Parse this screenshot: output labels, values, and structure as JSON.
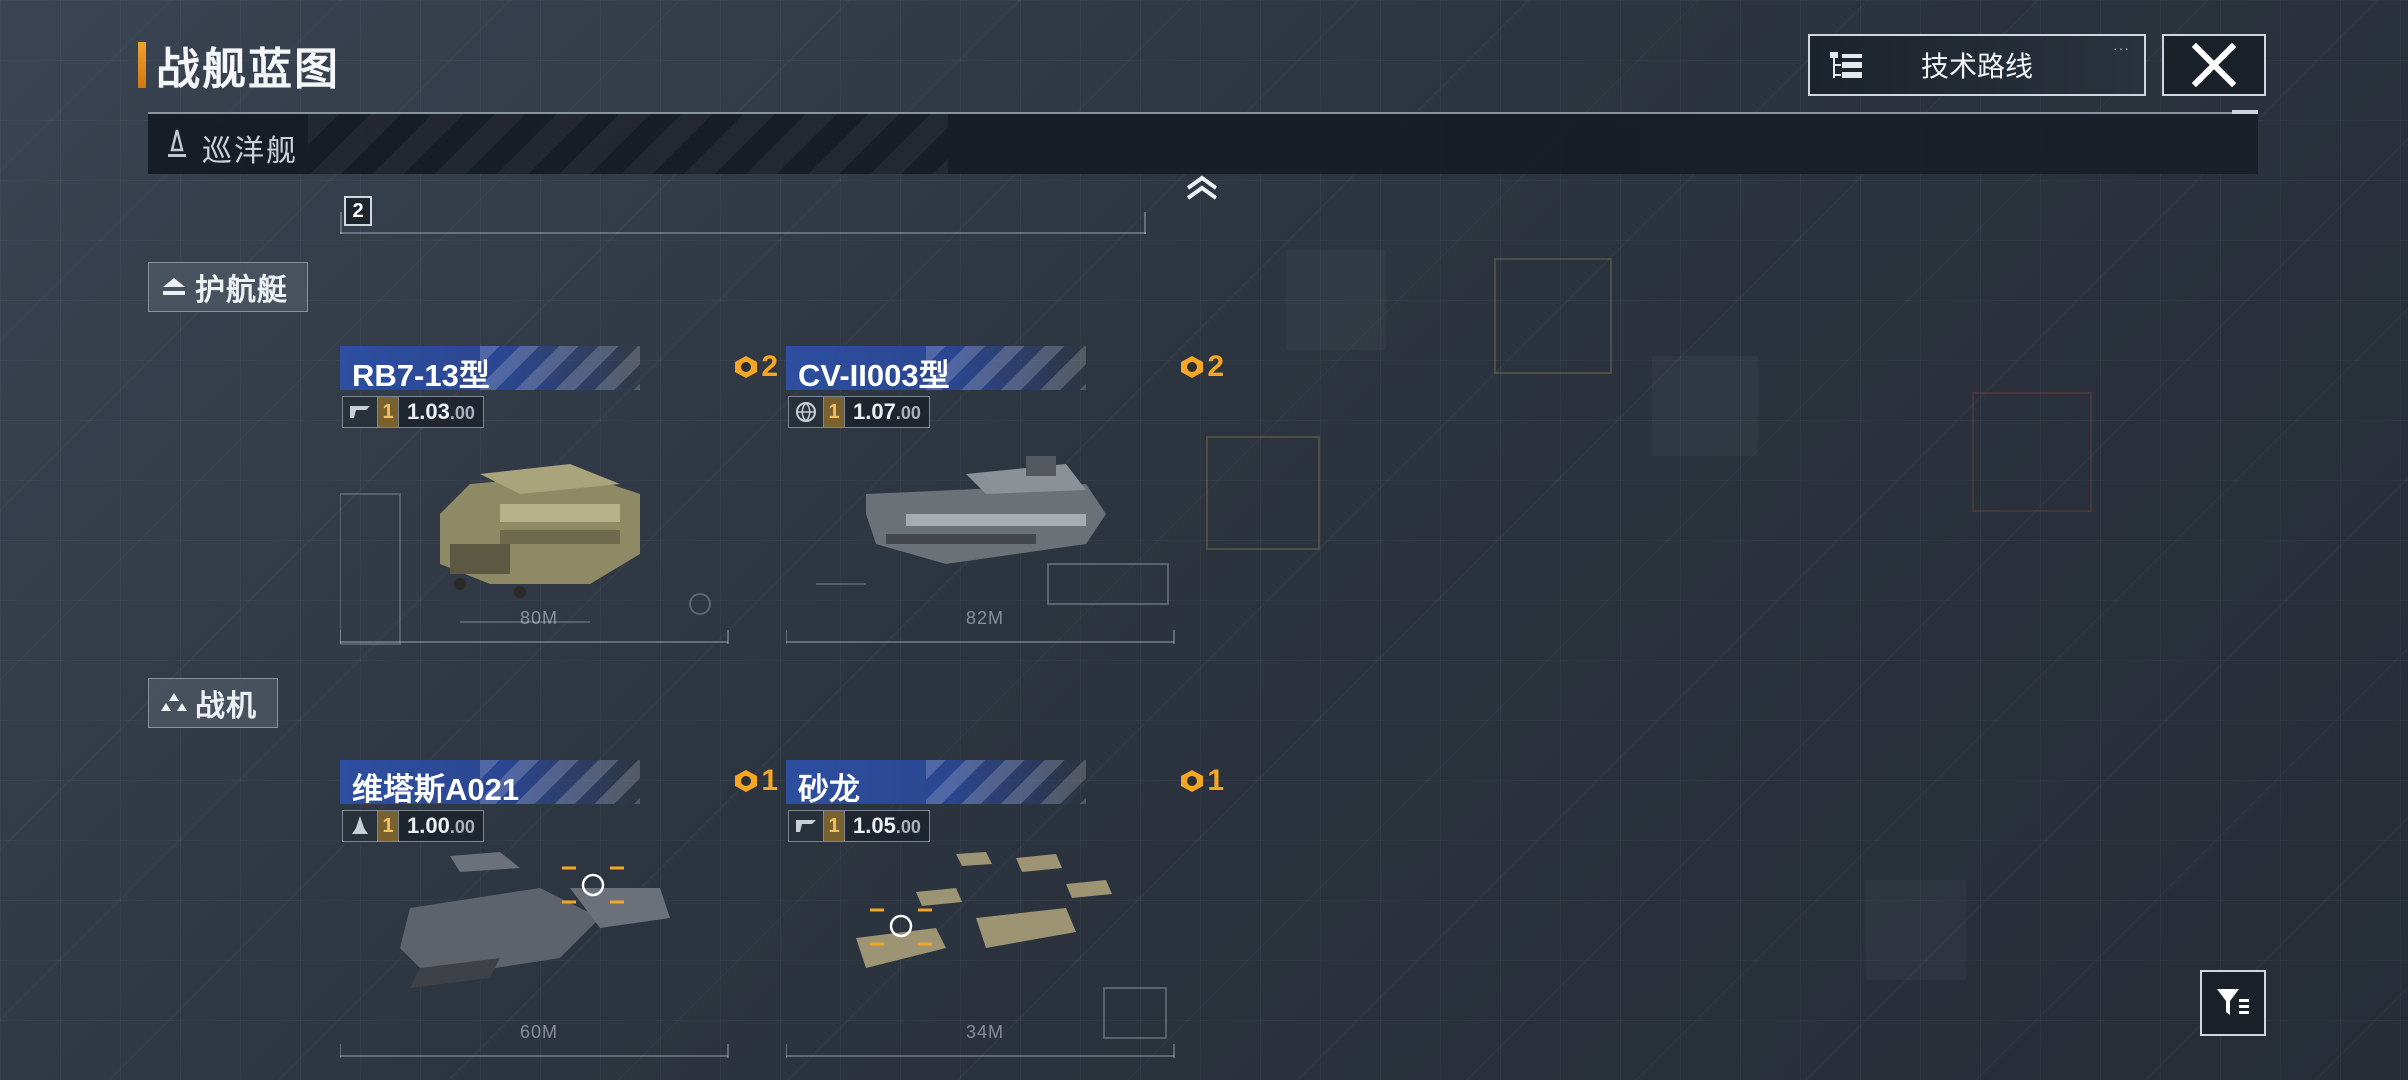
{
  "header": {
    "title": "战舰蓝图"
  },
  "toolbar": {
    "tech_route_label": "技术路线",
    "more_dots": "···"
  },
  "category": {
    "label": "巡洋舰",
    "hidden_count": "2"
  },
  "sections": [
    {
      "label": "护航艇",
      "cards": [
        {
          "name": "RB7-13型",
          "cost": "2",
          "tier": "1",
          "version_main": "1.03",
          "version_sub": ".00",
          "length": "80M",
          "type_icon": "fighter-logo-icon"
        },
        {
          "name": "CV-II003型",
          "cost": "2",
          "tier": "1",
          "version_main": "1.07",
          "version_sub": ".00",
          "length": "82M",
          "type_icon": "globe-icon"
        }
      ]
    },
    {
      "label": "战机",
      "cards": [
        {
          "name": "维塔斯A021",
          "cost": "1",
          "tier": "1",
          "version_main": "1.00",
          "version_sub": ".00",
          "length": "60M",
          "type_icon": "rocket-icon"
        },
        {
          "name": "砂龙",
          "cost": "1",
          "tier": "1",
          "version_main": "1.05",
          "version_sub": ".00",
          "length": "34M",
          "type_icon": "fighter-logo-icon"
        }
      ]
    }
  ],
  "colors": {
    "accent_orange": "#f5a623",
    "name_bar_blue": "#2d4fa0",
    "title_accent": "#f0a030"
  }
}
